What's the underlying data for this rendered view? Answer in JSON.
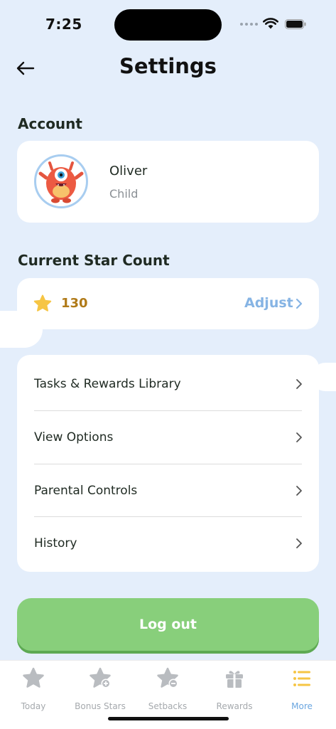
{
  "status_bar": {
    "time": "7:25"
  },
  "header": {
    "title": "Settings"
  },
  "account": {
    "section_title": "Account",
    "name": "Oliver",
    "role": "Child"
  },
  "stars": {
    "section_title": "Current Star Count",
    "count": "130",
    "adjust_label": "Adjust"
  },
  "menu": {
    "items": [
      {
        "label": "Tasks & Rewards Library"
      },
      {
        "label": "View Options"
      },
      {
        "label": "Parental Controls"
      },
      {
        "label": "History"
      }
    ]
  },
  "logout": {
    "label": "Log out"
  },
  "tabbar": {
    "tabs": [
      {
        "label": "Today",
        "icon": "star-icon"
      },
      {
        "label": "Bonus Stars",
        "icon": "bonus-star-icon"
      },
      {
        "label": "Setbacks",
        "icon": "setback-star-icon"
      },
      {
        "label": "Rewards",
        "icon": "gift-icon"
      },
      {
        "label": "More",
        "icon": "menu-icon",
        "active": true
      }
    ]
  },
  "colors": {
    "background": "#e4eefb",
    "accent_green": "#88cf7b",
    "adjust_blue": "#86b4e4",
    "star_gold": "#f6c544",
    "count_brown": "#b07a18",
    "active_tab": "#f6c544"
  }
}
